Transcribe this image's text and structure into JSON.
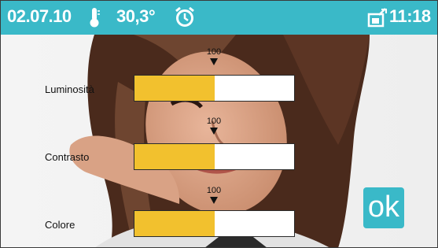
{
  "status_bar": {
    "date": "02.07.10",
    "temperature": "30,3°",
    "time": "11:18",
    "icons": [
      "thermometer-icon",
      "alarm-clock-icon",
      "message-icon"
    ]
  },
  "settings": [
    {
      "label": "Luminosità",
      "value": "100",
      "level": 0.5
    },
    {
      "label": "Contrasto",
      "value": "100",
      "level": 0.5
    },
    {
      "label": "Colore",
      "value": "100",
      "level": 0.5
    }
  ],
  "ok_button": {
    "label": "ok"
  },
  "colors": {
    "accent": "#3ab9c8",
    "slider_fill": "#f2c12e",
    "slider_empty": "#ffffff"
  }
}
